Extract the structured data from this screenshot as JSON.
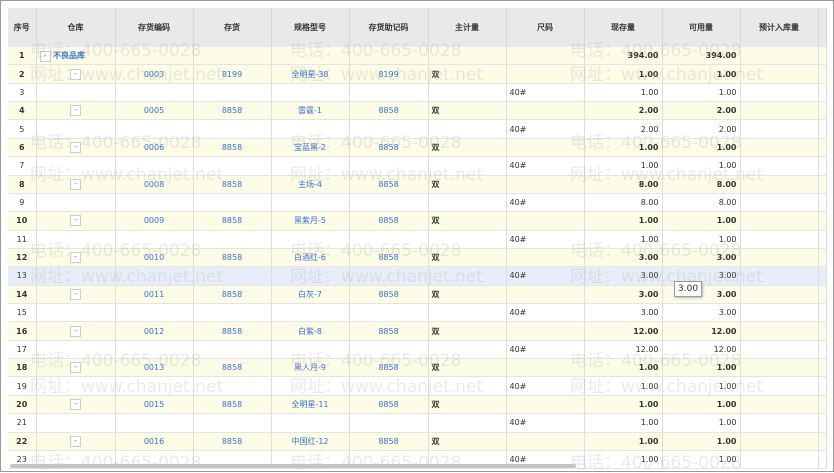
{
  "columns": [
    "序号",
    "仓库",
    "存货编码",
    "存货",
    "规格型号",
    "存货助记码",
    "主计量",
    "尺码",
    "现存量",
    "可用量",
    "预计入库量"
  ],
  "rows": [
    {
      "no": "1",
      "type": "grp",
      "warehouse": "不良品库",
      "code": "",
      "inv": "",
      "spec": "",
      "mnem": "",
      "unit": "",
      "size": "",
      "onhand": "394.00",
      "avail": "394.00",
      "expected": ""
    },
    {
      "no": "2",
      "type": "grp",
      "warehouse": "-",
      "code": "0003",
      "inv": "8199",
      "spec": "全明星-38",
      "mnem": "8199",
      "unit": "双",
      "size": "",
      "onhand": "1.00",
      "avail": "1.00",
      "expected": ""
    },
    {
      "no": "3",
      "type": "child",
      "warehouse": "",
      "code": "",
      "inv": "",
      "spec": "",
      "mnem": "",
      "unit": "",
      "size": "40#",
      "onhand": "1.00",
      "avail": "1.00",
      "expected": ""
    },
    {
      "no": "4",
      "type": "grp",
      "warehouse": "-",
      "code": "0005",
      "inv": "8858",
      "spec": "雷霆-1",
      "mnem": "8858",
      "unit": "双",
      "size": "",
      "onhand": "2.00",
      "avail": "2.00",
      "expected": ""
    },
    {
      "no": "5",
      "type": "child",
      "warehouse": "",
      "code": "",
      "inv": "",
      "spec": "",
      "mnem": "",
      "unit": "",
      "size": "40#",
      "onhand": "2.00",
      "avail": "2.00",
      "expected": ""
    },
    {
      "no": "6",
      "type": "grp",
      "warehouse": "-",
      "code": "0006",
      "inv": "8858",
      "spec": "宝蓝黑-2",
      "mnem": "8858",
      "unit": "双",
      "size": "",
      "onhand": "1.00",
      "avail": "1.00",
      "expected": ""
    },
    {
      "no": "7",
      "type": "child",
      "warehouse": "",
      "code": "",
      "inv": "",
      "spec": "",
      "mnem": "",
      "unit": "",
      "size": "40#",
      "onhand": "1.00",
      "avail": "1.00",
      "expected": ""
    },
    {
      "no": "8",
      "type": "grp",
      "warehouse": "-",
      "code": "0008",
      "inv": "8858",
      "spec": "主场-4",
      "mnem": "8858",
      "unit": "双",
      "size": "",
      "onhand": "8.00",
      "avail": "8.00",
      "expected": ""
    },
    {
      "no": "9",
      "type": "child",
      "warehouse": "",
      "code": "",
      "inv": "",
      "spec": "",
      "mnem": "",
      "unit": "",
      "size": "40#",
      "onhand": "8.00",
      "avail": "8.00",
      "expected": ""
    },
    {
      "no": "10",
      "type": "grp",
      "warehouse": "-",
      "code": "0009",
      "inv": "8858",
      "spec": "黑紫月-5",
      "mnem": "8858",
      "unit": "双",
      "size": "",
      "onhand": "1.00",
      "avail": "1.00",
      "expected": ""
    },
    {
      "no": "11",
      "type": "child",
      "warehouse": "",
      "code": "",
      "inv": "",
      "spec": "",
      "mnem": "",
      "unit": "",
      "size": "40#",
      "onhand": "1.00",
      "avail": "1.00",
      "expected": ""
    },
    {
      "no": "12",
      "type": "grp",
      "warehouse": "-",
      "code": "0010",
      "inv": "8858",
      "spec": "白酒红-6",
      "mnem": "8858",
      "unit": "双",
      "size": "",
      "onhand": "3.00",
      "avail": "3.00",
      "expected": ""
    },
    {
      "no": "13",
      "type": "sel",
      "warehouse": "",
      "code": "",
      "inv": "",
      "spec": "",
      "mnem": "",
      "unit": "",
      "size": "40#",
      "onhand": "3.00",
      "avail": "3.00",
      "expected": ""
    },
    {
      "no": "14",
      "type": "grp",
      "warehouse": "-",
      "code": "0011",
      "inv": "8858",
      "spec": "白灰-7",
      "mnem": "8858",
      "unit": "双",
      "size": "",
      "onhand": "3.00",
      "avail": "3.00",
      "expected": ""
    },
    {
      "no": "15",
      "type": "child",
      "warehouse": "",
      "code": "",
      "inv": "",
      "spec": "",
      "mnem": "",
      "unit": "",
      "size": "40#",
      "onhand": "3.00",
      "avail": "3.00",
      "expected": ""
    },
    {
      "no": "16",
      "type": "grp",
      "warehouse": "-",
      "code": "0012",
      "inv": "8858",
      "spec": "白紫-8",
      "mnem": "8858",
      "unit": "双",
      "size": "",
      "onhand": "12.00",
      "avail": "12.00",
      "expected": ""
    },
    {
      "no": "17",
      "type": "child",
      "warehouse": "",
      "code": "",
      "inv": "",
      "spec": "",
      "mnem": "",
      "unit": "",
      "size": "40#",
      "onhand": "12.00",
      "avail": "12.00",
      "expected": ""
    },
    {
      "no": "18",
      "type": "grp",
      "warehouse": "-",
      "code": "0013",
      "inv": "8858",
      "spec": "黑人月-9",
      "mnem": "8858",
      "unit": "双",
      "size": "",
      "onhand": "1.00",
      "avail": "1.00",
      "expected": ""
    },
    {
      "no": "19",
      "type": "child",
      "warehouse": "",
      "code": "",
      "inv": "",
      "spec": "",
      "mnem": "",
      "unit": "",
      "size": "40#",
      "onhand": "1.00",
      "avail": "1.00",
      "expected": ""
    },
    {
      "no": "20",
      "type": "grp",
      "warehouse": "-",
      "code": "0015",
      "inv": "8858",
      "spec": "全明星-11",
      "mnem": "8858",
      "unit": "双",
      "size": "",
      "onhand": "1.00",
      "avail": "1.00",
      "expected": ""
    },
    {
      "no": "21",
      "type": "child",
      "warehouse": "",
      "code": "",
      "inv": "",
      "spec": "",
      "mnem": "",
      "unit": "",
      "size": "40#",
      "onhand": "1.00",
      "avail": "1.00",
      "expected": ""
    },
    {
      "no": "22",
      "type": "grp",
      "warehouse": "-",
      "code": "0016",
      "inv": "8858",
      "spec": "中国红-12",
      "mnem": "8858",
      "unit": "双",
      "size": "",
      "onhand": "1.00",
      "avail": "1.00",
      "expected": ""
    },
    {
      "no": "23",
      "type": "child",
      "warehouse": "",
      "code": "",
      "inv": "",
      "spec": "",
      "mnem": "",
      "unit": "",
      "size": "40#",
      "onhand": "1.00",
      "avail": "1.00",
      "expected": ""
    }
  ],
  "tooltip": "3.00",
  "watermark": {
    "phone": "电话：400-665-0028",
    "site": "网址：www.chanjet.net"
  }
}
